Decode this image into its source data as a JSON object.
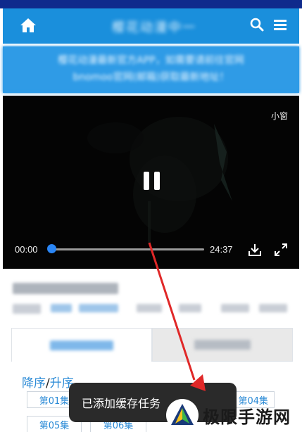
{
  "header": {
    "title": "樱花动漫中一",
    "icons": [
      "home-icon",
      "search-icon",
      "menu-icon"
    ],
    "color": "#1a8fdc"
  },
  "notice": {
    "line1": "樱花动漫最新官方APP，如需要请前往官网",
    "line2": "bnomoo官网(邮箱)获取最新地址！"
  },
  "player": {
    "mini_window_label": "小窗",
    "current_time": "00:00",
    "duration": "24:37",
    "progress": 0,
    "icons": [
      "pause-icon",
      "download-icon",
      "fullscreen-icon"
    ],
    "accent": "#2a86f6"
  },
  "tabs": [
    {
      "label": "播放地址1"
    },
    {
      "label": "播放地址2"
    }
  ],
  "sort": {
    "desc_label": "降序",
    "separator": "/",
    "asc_label": "升序"
  },
  "episodes": [
    "第01集",
    "第05集",
    "第06集",
    "第04集"
  ],
  "toast": {
    "message": "已添加缓存任务"
  },
  "watermark": {
    "text": "极限手游网"
  }
}
